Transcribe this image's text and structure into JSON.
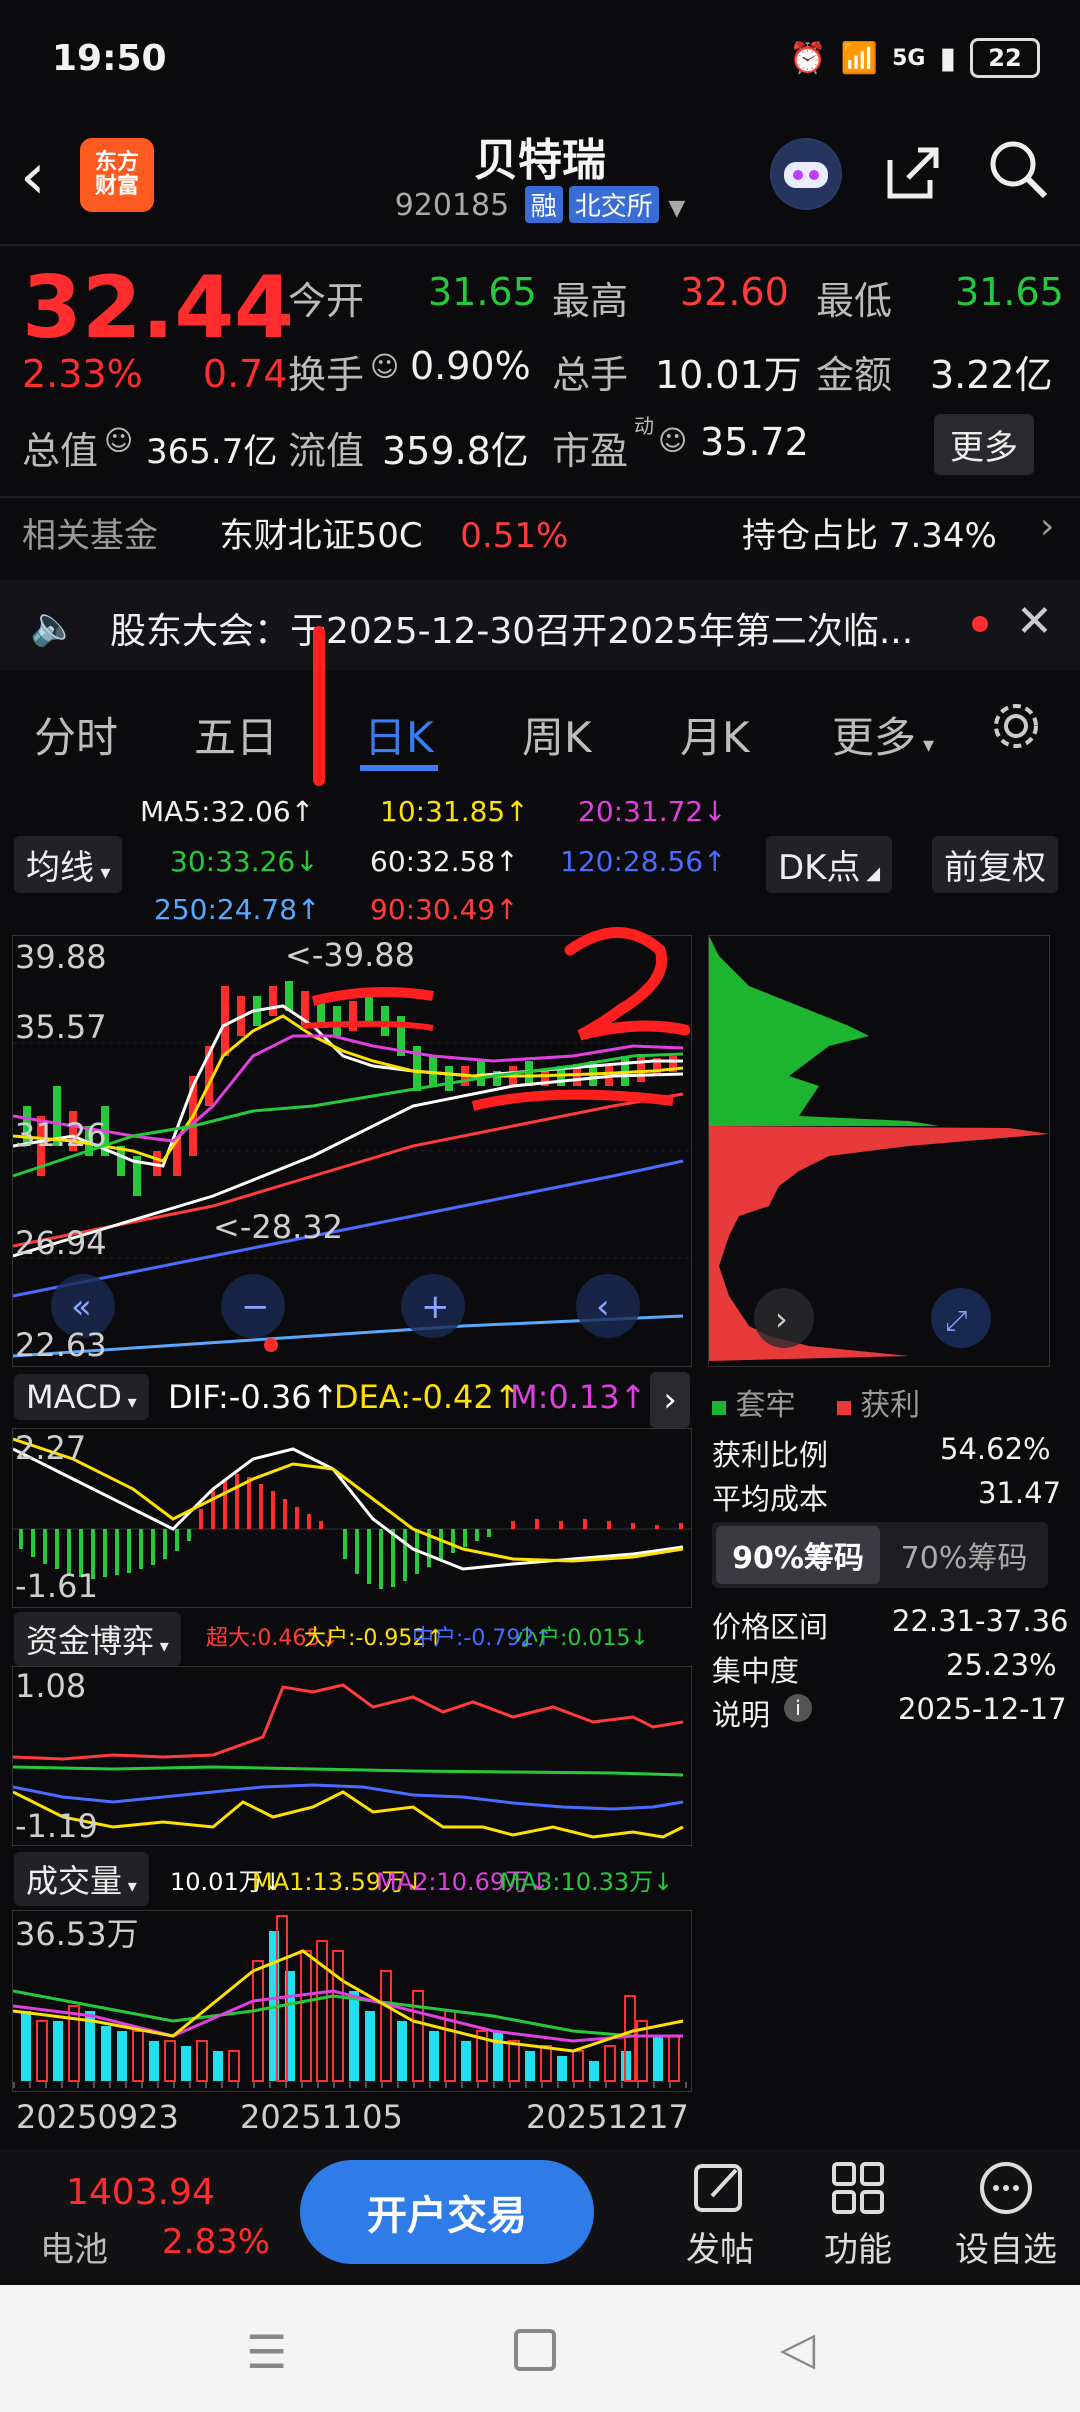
{
  "status": {
    "time": "19:50",
    "signal": "5G",
    "battery": "22"
  },
  "header": {
    "logo_line1": "东方",
    "logo_line2": "财富",
    "title": "贝特瑞",
    "code": "920185",
    "tag_margin": "融",
    "tag_exchange": "北交所"
  },
  "quote": {
    "price": "32.44",
    "pct": "2.33%",
    "chg": "0.74",
    "open_label": "今开",
    "open": "31.65",
    "high_label": "最高",
    "high": "32.60",
    "low_label": "最低",
    "low": "31.65",
    "turnover_label": "换手",
    "turnover": "0.90%",
    "volume_label": "总手",
    "volume": "10.01万",
    "amount_label": "金额",
    "amount": "3.22亿",
    "mktcap_label": "总值",
    "mktcap": "365.7亿",
    "float_label": "流值",
    "float": "359.8亿",
    "pe_label": "市盈",
    "pe_sup": "动",
    "pe": "35.72",
    "more_label": "更多"
  },
  "fund": {
    "label": "相关基金",
    "name": "东财北证50C",
    "pct": "0.51%",
    "hold_label": "持仓占比",
    "hold": "7.34%"
  },
  "notice": {
    "text": "股东大会：于2025-12-30召开2025年第二次临..."
  },
  "tabs": [
    "分时",
    "五日",
    "日K",
    "周K",
    "月K",
    "更多"
  ],
  "ma": {
    "ma5": "MA5:32.06↑",
    "ma10": "10:31.85↑",
    "ma20": "20:31.72↓",
    "ma30": "30:33.26↓",
    "ma60": "60:32.58↑",
    "ma120": "120:28.56↑",
    "ma250": "250:24.78↑",
    "ma90": "90:30.49↑",
    "btn_ma": "均线",
    "btn_dk": "DK点",
    "btn_fq": "前复权"
  },
  "kline": {
    "y_top": "39.88",
    "y2": "35.57",
    "y3": "31.26",
    "y4": "26.94",
    "y_bottom": "22.63",
    "high_mark": "<-39.88",
    "low_mark": "<-28.32"
  },
  "macd": {
    "btn": "MACD",
    "dif": "DIF:-0.36↑",
    "dea": "DEA:-0.42↑",
    "m": "M:0.13↑",
    "y_top": "2.27",
    "y_bottom": "-1.61"
  },
  "fundflow": {
    "btn": "资金博弈",
    "super": "超大:0.465↓",
    "big": "大户:-0.952↑",
    "mid": "中户:-0.792↑",
    "small": "小户:0.015↓",
    "y_top": "1.08",
    "y_bottom": "-1.19"
  },
  "volume": {
    "btn": "成交量",
    "v": "10.01万↓",
    "ma1": "MA1:13.59万↓",
    "ma2": "MA2:10.69万↓",
    "ma3": "MA3:10.33万↓",
    "y_top": "36.53万",
    "dates": [
      "20250923",
      "20251105",
      "20251217"
    ]
  },
  "chips": {
    "legend_trap": "套牢",
    "legend_profit": "获利",
    "profit_ratio_label": "获利比例",
    "profit_ratio": "54.62%",
    "avg_cost_label": "平均成本",
    "avg_cost": "31.47",
    "tab90": "90%筹码",
    "tab70": "70%筹码",
    "range_label": "价格区间",
    "range": "22.31-37.36",
    "conc_label": "集中度",
    "conc": "25.23%",
    "note_label": "说明",
    "note_date": "2025-12-17"
  },
  "bottom": {
    "index_value": "1403.94",
    "index_name": "电池",
    "index_pct": "2.83%",
    "trade_btn": "开户交易",
    "post": "发帖",
    "func": "功能",
    "watch": "设自选"
  },
  "colors": {
    "up": "#ff2d2d",
    "down": "#25c93b",
    "accent": "#3b7cf0",
    "ma5": "#ffffff",
    "ma10": "#ffe100",
    "ma20": "#e040e0",
    "ma30": "#25c93b",
    "ma60": "#ffffff",
    "ma120": "#4a6bff",
    "ma250": "#5aa9ff",
    "ma90": "#ff3b3b"
  }
}
